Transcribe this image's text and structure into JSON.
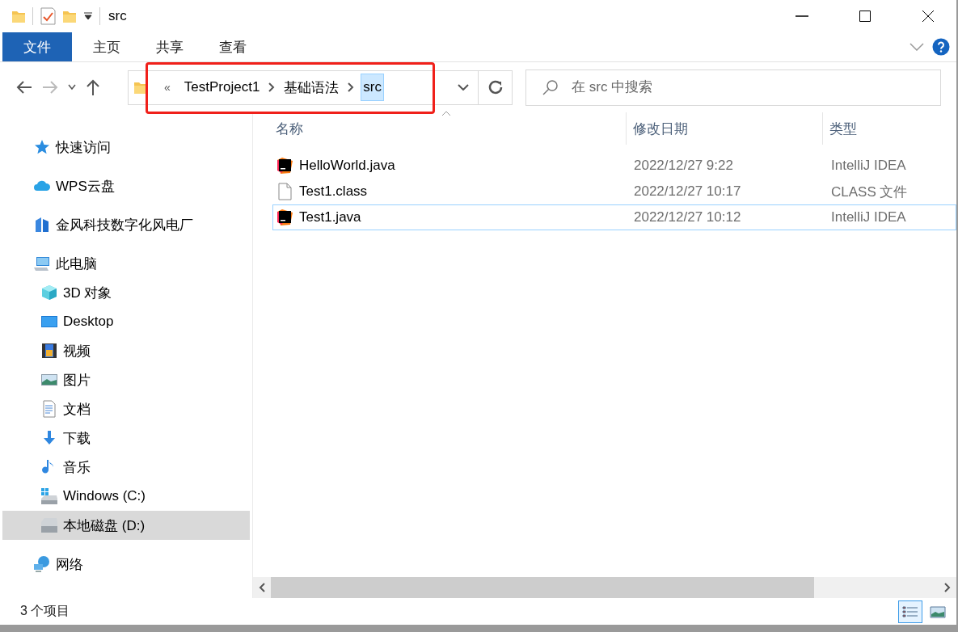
{
  "window": {
    "title": "src"
  },
  "ribbon_tabs": [
    {
      "label": "文件",
      "kind": "file"
    },
    {
      "label": "主页",
      "kind": "tab"
    },
    {
      "label": "共享",
      "kind": "tab"
    },
    {
      "label": "查看",
      "kind": "tab"
    }
  ],
  "address": {
    "overflow": "«",
    "crumbs": [
      {
        "label": "TestProject1",
        "selected": false
      },
      {
        "label": "基础语法",
        "selected": false
      },
      {
        "label": "src",
        "selected": true
      }
    ]
  },
  "search": {
    "placeholder": "在 src 中搜索"
  },
  "sidebar": {
    "items": [
      {
        "label": "快速访问",
        "selected": false
      },
      {
        "label": "WPS云盘",
        "selected": false
      },
      {
        "label": "金风科技数字化风电厂",
        "selected": false
      },
      {
        "label": "此电脑",
        "selected": false,
        "children": [
          {
            "label": "3D 对象",
            "selected": false
          },
          {
            "label": "Desktop",
            "selected": false
          },
          {
            "label": "视频",
            "selected": false
          },
          {
            "label": "图片",
            "selected": false
          },
          {
            "label": "文档",
            "selected": false
          },
          {
            "label": "下载",
            "selected": false
          },
          {
            "label": "音乐",
            "selected": false
          },
          {
            "label": "Windows (C:)",
            "selected": false
          },
          {
            "label": "本地磁盘 (D:)",
            "selected": true
          }
        ]
      },
      {
        "label": "网络",
        "selected": false
      }
    ]
  },
  "table": {
    "columns": [
      "名称",
      "修改日期",
      "类型"
    ],
    "rows": [
      {
        "name": "HelloWorld.java",
        "date": "2022/12/27 9:22",
        "type": "IntelliJ IDEA",
        "kind": "idea",
        "selected": false
      },
      {
        "name": "Test1.class",
        "date": "2022/12/27 10:17",
        "type": "CLASS 文件",
        "kind": "file",
        "selected": false
      },
      {
        "name": "Test1.java",
        "date": "2022/12/27 10:12",
        "type": "IntelliJ IDEA",
        "kind": "idea",
        "selected": true
      }
    ]
  },
  "status_bar": {
    "count": "3 个项目",
    "views": [
      {
        "kind": "details",
        "selected": true
      },
      {
        "kind": "large",
        "selected": false
      }
    ]
  }
}
